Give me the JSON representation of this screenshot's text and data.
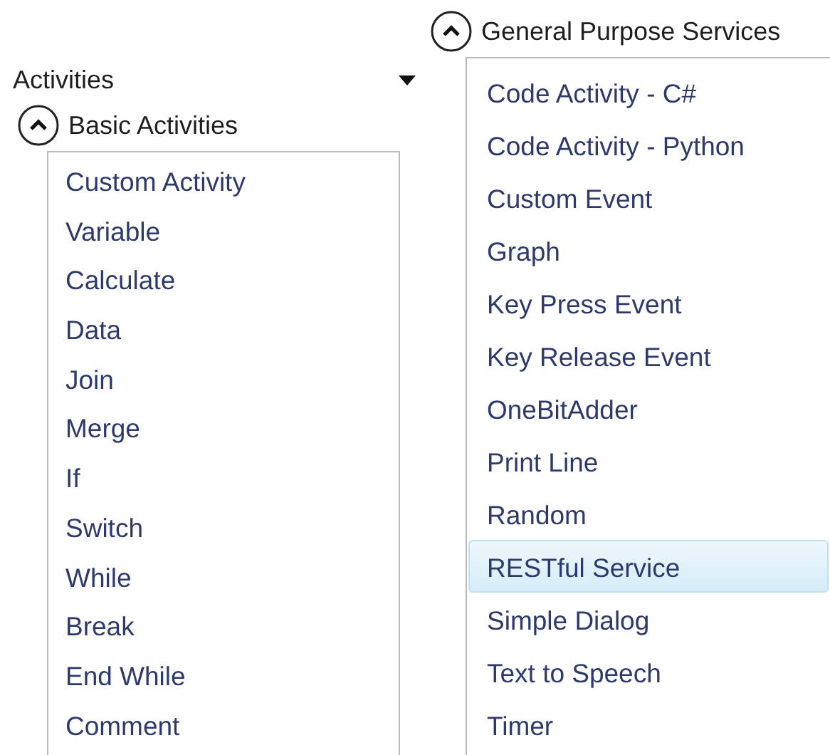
{
  "panel": {
    "title": "Activities"
  },
  "groups": [
    {
      "title": "Basic Activities",
      "expanded": true,
      "items": [
        {
          "label": "Custom Activity",
          "selected": false
        },
        {
          "label": "Variable",
          "selected": false
        },
        {
          "label": "Calculate",
          "selected": false
        },
        {
          "label": "Data",
          "selected": false
        },
        {
          "label": "Join",
          "selected": false
        },
        {
          "label": "Merge",
          "selected": false
        },
        {
          "label": "If",
          "selected": false
        },
        {
          "label": "Switch",
          "selected": false
        },
        {
          "label": "While",
          "selected": false
        },
        {
          "label": "Break",
          "selected": false
        },
        {
          "label": "End While",
          "selected": false
        },
        {
          "label": "Comment",
          "selected": false
        }
      ]
    },
    {
      "title": "General Purpose Services",
      "expanded": true,
      "items": [
        {
          "label": "Code Activity - C#",
          "selected": false
        },
        {
          "label": "Code Activity - Python",
          "selected": false
        },
        {
          "label": "Custom Event",
          "selected": false
        },
        {
          "label": "Graph",
          "selected": false
        },
        {
          "label": "Key Press Event",
          "selected": false
        },
        {
          "label": "Key Release Event",
          "selected": false
        },
        {
          "label": "OneBitAdder",
          "selected": false
        },
        {
          "label": "Print Line",
          "selected": false
        },
        {
          "label": "Random",
          "selected": false
        },
        {
          "label": "RESTful Service",
          "selected": true
        },
        {
          "label": "Simple Dialog",
          "selected": false
        },
        {
          "label": "Text to Speech",
          "selected": false
        },
        {
          "label": "Timer",
          "selected": false
        }
      ]
    }
  ]
}
